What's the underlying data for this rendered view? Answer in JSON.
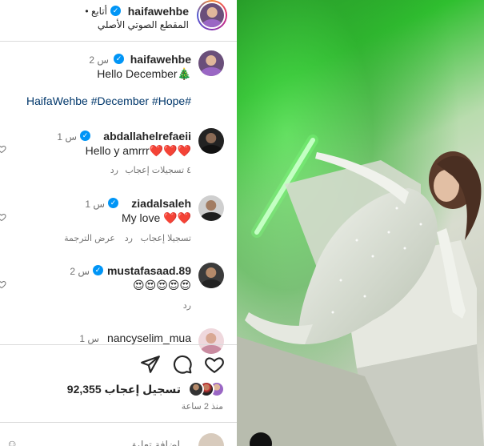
{
  "header": {
    "username": "haifawehbe",
    "follow_label": "• أتابع",
    "audio_label": "المقطع الصوتي الأصلي"
  },
  "caption": {
    "username": "haifawehbe",
    "time": "2 س",
    "text": "Hello December🎄",
    "hashtags": "HaifaWehbe #December #Hope#"
  },
  "comments": [
    {
      "username": "abdallahelrefaeii",
      "verified": true,
      "time": "1 س",
      "text": "Hello y amrrr❤️❤️❤️",
      "actions": [
        "٤ تسجيلات إعجاب",
        "رد"
      ]
    },
    {
      "username": "ziadalsaleh",
      "verified": true,
      "time": "1 س",
      "text": "My love ❤️❤️",
      "actions": [
        "تسجيلا إعجاب",
        "رد",
        "عرض الترجمة"
      ]
    },
    {
      "username": "mustafasaad.89",
      "verified": true,
      "time": "2 س",
      "text": "😍😍😍😍😍",
      "actions": [
        "رد"
      ]
    },
    {
      "username": "nancyselim_mua",
      "verified": false,
      "time": "1 س",
      "text": "",
      "actions": []
    }
  ],
  "actions": {
    "like_icon": "heart-icon",
    "comment_icon": "comment-icon",
    "share_icon": "send-icon",
    "likes_count": "92,355",
    "likes_label": "تسجيل إعجاب",
    "posted": "منذ 2 ساعة"
  },
  "add_comment": {
    "placeholder": "إضافة تعليق..."
  },
  "colors": {
    "verified": "#0095f6",
    "link": "#00376b",
    "muted": "#737373",
    "photo_green": "#2fbf2f"
  }
}
